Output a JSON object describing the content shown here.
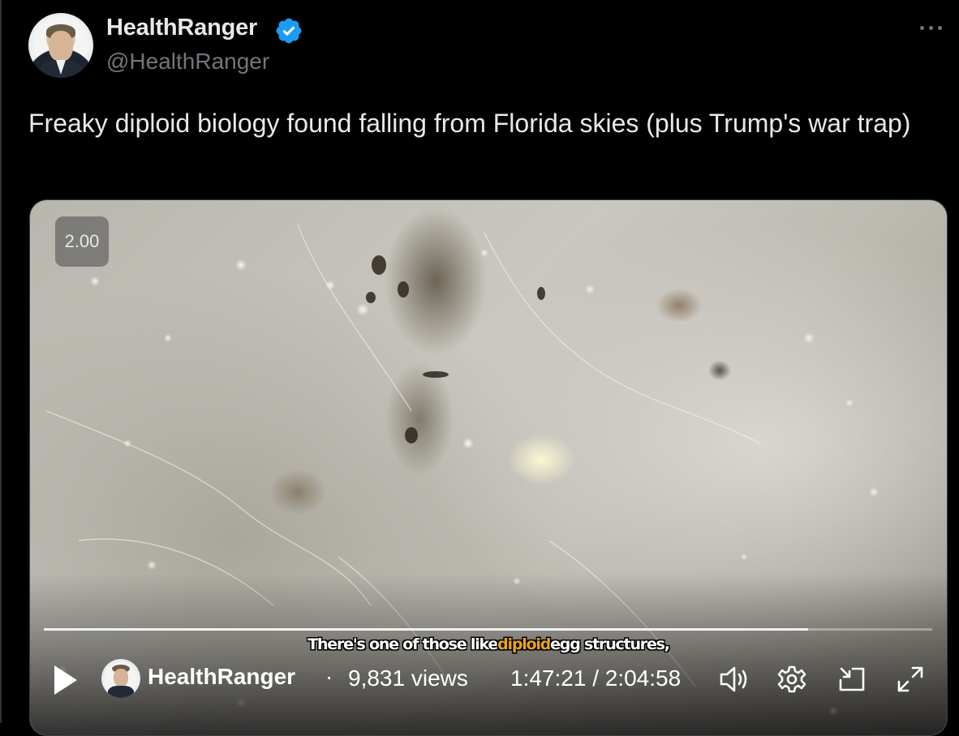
{
  "post": {
    "display_name": "HealthRanger",
    "handle": "@HealthRanger",
    "verified": true,
    "text": "Freaky diploid biology found falling from Florida skies (plus Trump's war trap)"
  },
  "video": {
    "playback_speed": "2.00",
    "progress_fraction": 0.86,
    "caption": {
      "before": "There's one of those like",
      "highlight": "diploid",
      "after": "egg structures,"
    },
    "channel_name": "HealthRanger",
    "separator": "·",
    "views": "9,831 views",
    "time": "1:47:21 / 2:04:58"
  },
  "icons": {
    "verified": "verified-badge-icon",
    "more": "more-options-icon",
    "play": "play-icon",
    "volume": "volume-icon",
    "settings": "gear-icon",
    "pip": "picture-in-picture-icon",
    "fullscreen": "fullscreen-icon"
  },
  "colors": {
    "verified_blue": "#1d9bf0",
    "caption_highlight": "#e7a51b",
    "muted_text": "#71767b"
  }
}
